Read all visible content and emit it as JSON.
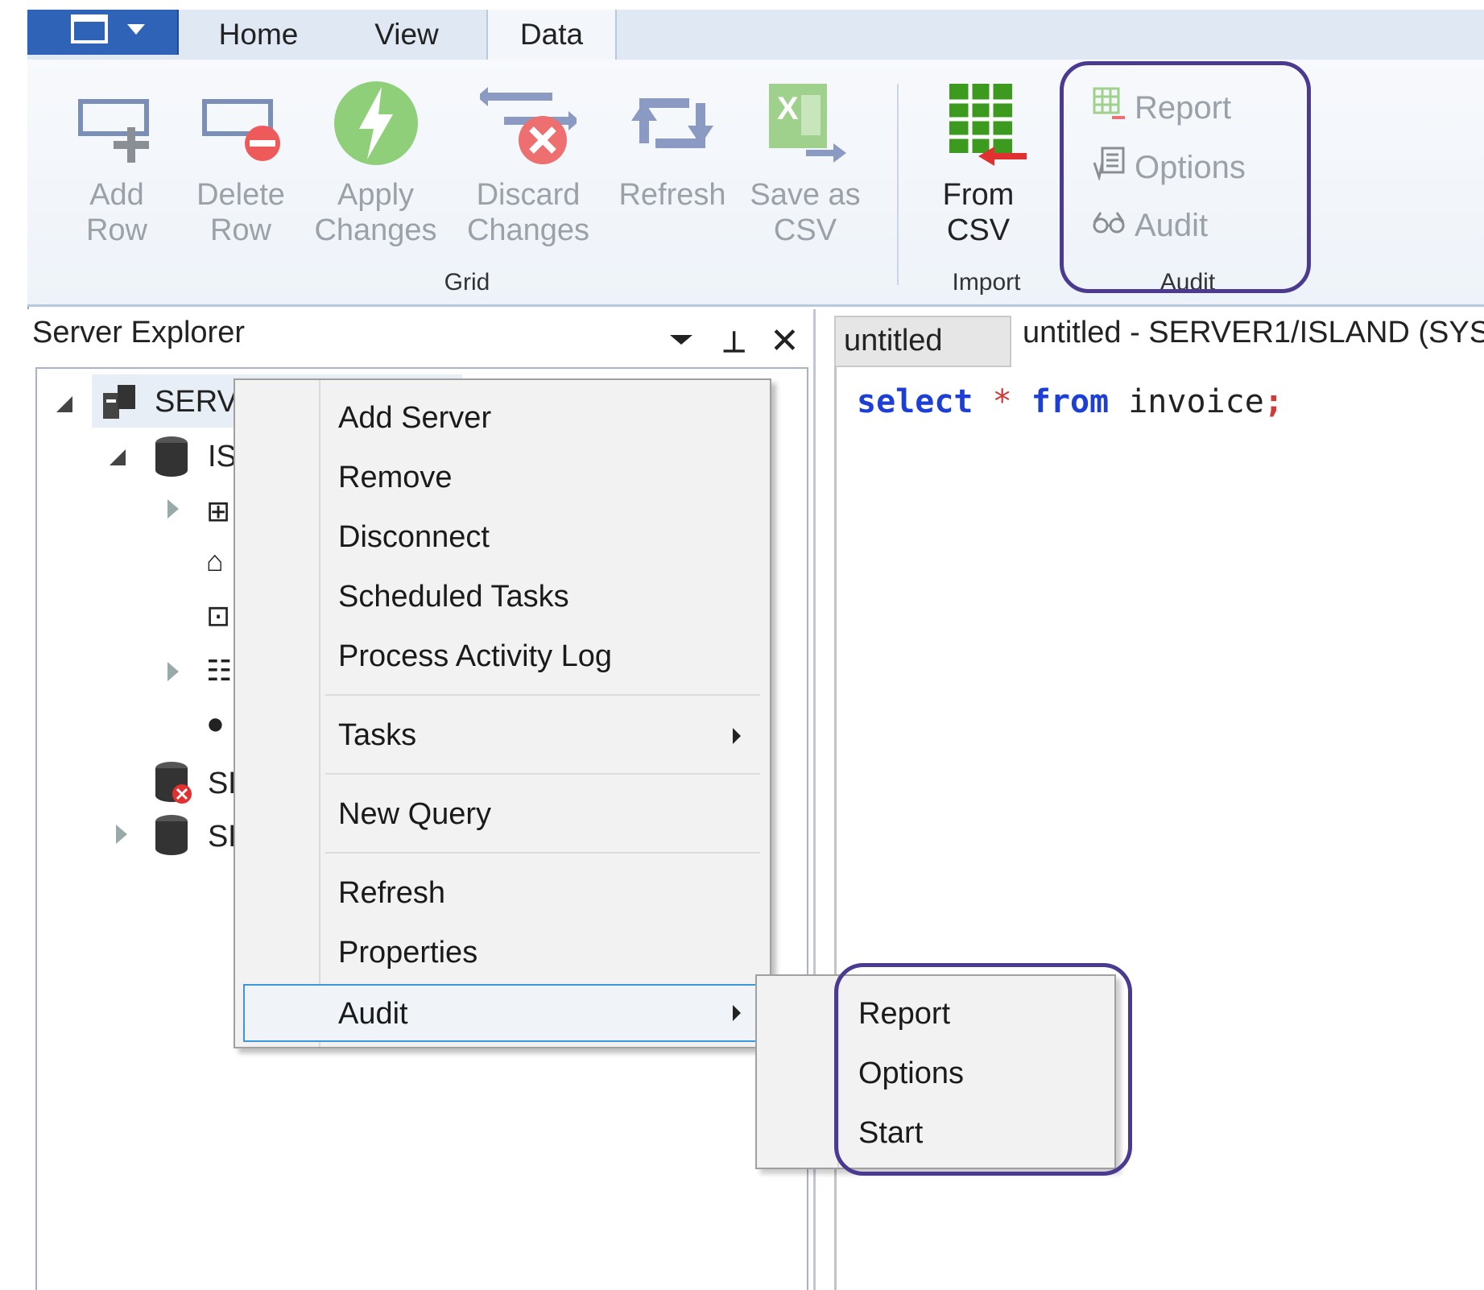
{
  "ribbon": {
    "tabs": [
      "Home",
      "View",
      "Data"
    ],
    "active_tab": "Data",
    "grid_group": {
      "label": "Grid",
      "buttons": [
        {
          "label": "Add\nRow",
          "icon": "add-row-icon"
        },
        {
          "label": "Delete\nRow",
          "icon": "delete-row-icon"
        },
        {
          "label": "Apply\nChanges",
          "icon": "lightning-icon"
        },
        {
          "label": "Discard\nChanges",
          "icon": "discard-changes-icon"
        },
        {
          "label": "Refresh",
          "icon": "refresh-icon"
        },
        {
          "label": "Save as\nCSV",
          "icon": "excel-export-icon"
        }
      ]
    },
    "import_group": {
      "label": "Import",
      "button": {
        "label": "From\nCSV",
        "icon": "import-grid-icon"
      }
    },
    "audit_group": {
      "label": "Audit",
      "items": [
        {
          "label": "Report",
          "icon": "report-grid-icon"
        },
        {
          "label": "Options",
          "icon": "options-icon"
        },
        {
          "label": "Audit",
          "icon": "glasses-icon"
        }
      ]
    }
  },
  "explorer": {
    "title": "Server Explorer",
    "tree": [
      {
        "text": "SERV",
        "icon": "server-icon"
      },
      {
        "text": "IS",
        "icon": "database-icon"
      },
      {
        "text": "SE",
        "icon": "database-error-icon"
      },
      {
        "text": "SE",
        "icon": "database-icon"
      }
    ]
  },
  "editor": {
    "tab": "untitled",
    "title": "untitled - SERVER1/ISLAND (SYS",
    "sql": {
      "kw1": "select",
      "star": "*",
      "kw2": "from",
      "ident": "invoice",
      "semi": ";"
    }
  },
  "context_menu": {
    "items": [
      "Add Server",
      "Remove",
      "Disconnect",
      "Scheduled Tasks",
      "Process Activity Log",
      "Tasks",
      "New Query",
      "Refresh",
      "Properties",
      "Audit"
    ],
    "highlighted": "Audit",
    "submenu": [
      "Report",
      "Options",
      "Start"
    ]
  },
  "colors": {
    "accent": "#2e63b8",
    "highlight_border": "#4b3a8f",
    "keyword": "#1d3fd6",
    "selection": "#3a96dd"
  }
}
